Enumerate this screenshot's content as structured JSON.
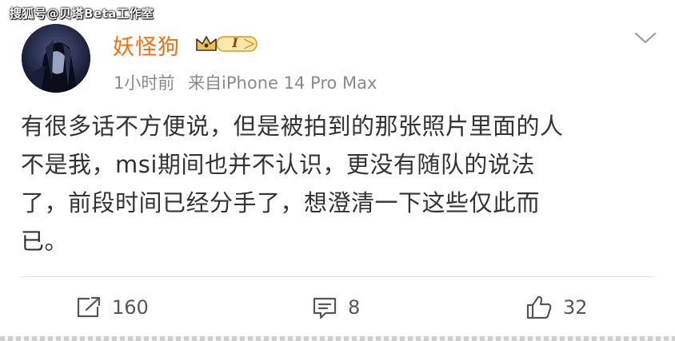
{
  "watermark": "搜狐号@贝塔Beta工作室",
  "post": {
    "author": "妖怪狗",
    "vip_level": "I",
    "time": "1小时前",
    "source": "来自iPhone 14 Pro Max",
    "lines": [
      "有很多话不方便说，但是被拍到的那张照片里面的人",
      "不是我，msi期间也并不认识，更没有随队的说法",
      "了，前段时间已经分手了，想澄清一下这些仅此而",
      "已。"
    ]
  },
  "actions": {
    "repost_count": "160",
    "comment_count": "8",
    "like_count": "32"
  },
  "colors": {
    "author": "#f56e0d",
    "meta": "#8a8a8a",
    "text": "#333333",
    "badge_gold": "#f5c242"
  },
  "icons": [
    "avatar-image",
    "crown-icon",
    "chevron-down-icon",
    "repost-icon",
    "comment-icon",
    "like-icon"
  ]
}
